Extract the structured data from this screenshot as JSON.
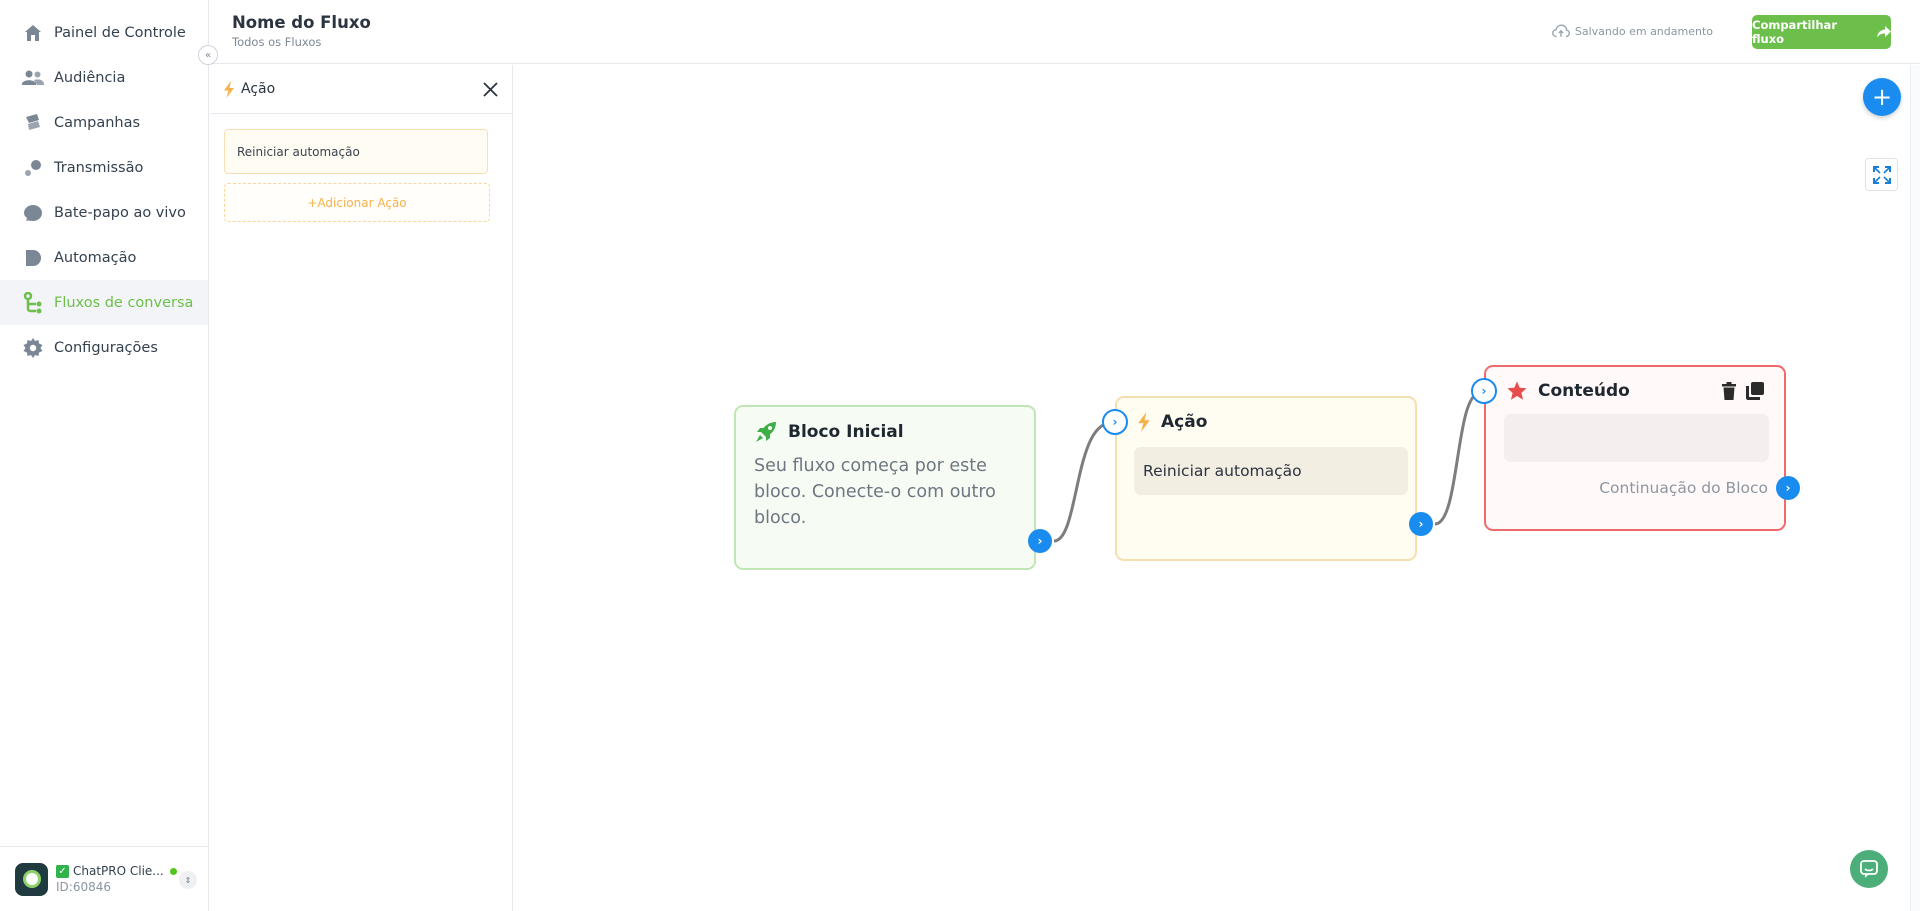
{
  "sidebar": {
    "items": [
      {
        "label": "Painel de Controle",
        "icon": "home-icon"
      },
      {
        "label": "Audiência",
        "icon": "users-icon"
      },
      {
        "label": "Campanhas",
        "icon": "campaign-icon"
      },
      {
        "label": "Transmissão",
        "icon": "broadcast-icon"
      },
      {
        "label": "Bate-papo ao vivo",
        "icon": "chat-bubble-icon"
      },
      {
        "label": "Automação",
        "icon": "automation-icon"
      },
      {
        "label": "Fluxos de conversa",
        "icon": "flow-icon",
        "active": true
      },
      {
        "label": "Configurações",
        "icon": "gear-icon"
      }
    ],
    "account": {
      "name": "ChatPRO Clie...",
      "id": "ID:60846"
    }
  },
  "header": {
    "title": "Nome do Fluxo",
    "subtitle": "Todos os Fluxos",
    "saving": "Salvando em andamento",
    "share_label": "Compartilhar fluxo"
  },
  "panel": {
    "title": "Ação",
    "action_item": "Reiniciar automação",
    "add_action": "+Adicionar Ação"
  },
  "canvas": {
    "start_block": {
      "title": "Bloco Inicial",
      "description": "Seu fluxo começa por este bloco. Conecte-o com outro bloco."
    },
    "action_block": {
      "title": "Ação",
      "action": "Reiniciar automação"
    },
    "content_block": {
      "title": "Conteúdo",
      "continuation": "Continuação do Bloco"
    }
  },
  "colors": {
    "accent_green": "#6dbf4b",
    "primary_blue": "#1a8cf0",
    "action_yellow": "#f5b24b",
    "content_red": "#ef6b6b"
  }
}
